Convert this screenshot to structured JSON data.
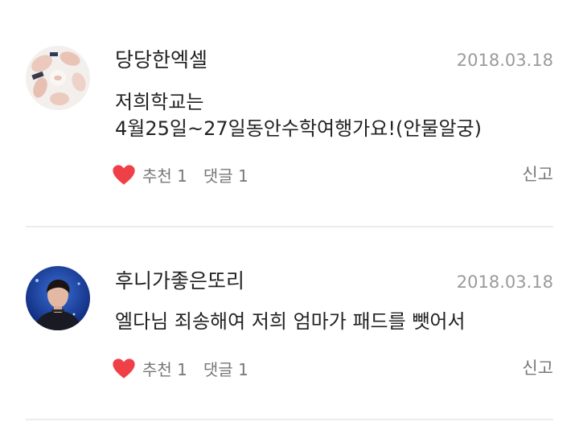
{
  "comments": [
    {
      "author": "당당한엑셀",
      "date": "2018.03.18",
      "text_lines": [
        "저희학교는",
        "4월25일~27일동안수학여행가요!(안물알궁)"
      ],
      "like_label": "추천",
      "like_count": "1",
      "reply_label": "댓글 1",
      "report_label": "신고",
      "heart_color": "#ef4048",
      "avatar_icon": "hands-photo-avatar"
    },
    {
      "author": "후니가좋은또리",
      "date": "2018.03.18",
      "text_lines": [
        "엘다님 죄송해여 저희 엄마가 패드를 뺏어서"
      ],
      "like_label": "추천",
      "like_count": "1",
      "reply_label": "댓글 1",
      "report_label": "신고",
      "heart_color": "#ef4048",
      "avatar_icon": "person-photo-avatar"
    }
  ]
}
